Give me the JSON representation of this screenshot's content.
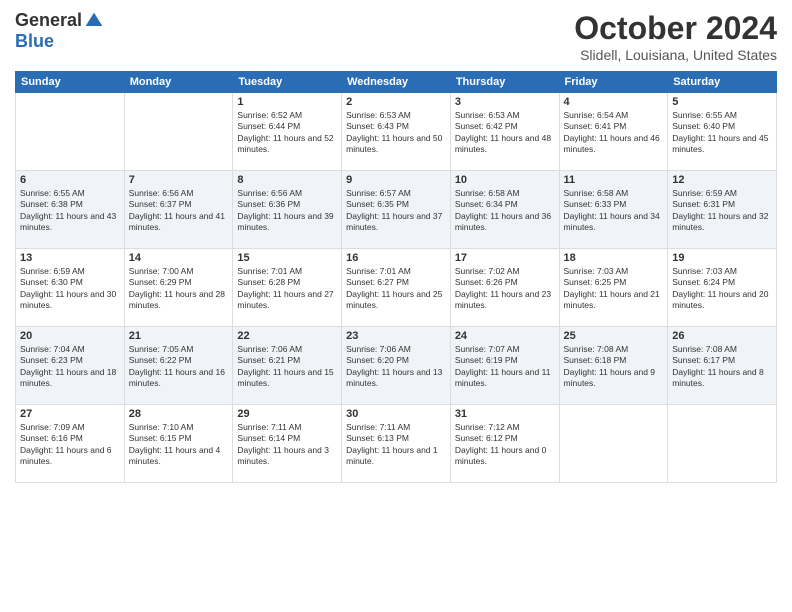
{
  "logo": {
    "general": "General",
    "blue": "Blue"
  },
  "header": {
    "month": "October 2024",
    "location": "Slidell, Louisiana, United States"
  },
  "days_of_week": [
    "Sunday",
    "Monday",
    "Tuesday",
    "Wednesday",
    "Thursday",
    "Friday",
    "Saturday"
  ],
  "weeks": [
    [
      {
        "num": "",
        "info": ""
      },
      {
        "num": "",
        "info": ""
      },
      {
        "num": "1",
        "info": "Sunrise: 6:52 AM\nSunset: 6:44 PM\nDaylight: 11 hours and 52 minutes."
      },
      {
        "num": "2",
        "info": "Sunrise: 6:53 AM\nSunset: 6:43 PM\nDaylight: 11 hours and 50 minutes."
      },
      {
        "num": "3",
        "info": "Sunrise: 6:53 AM\nSunset: 6:42 PM\nDaylight: 11 hours and 48 minutes."
      },
      {
        "num": "4",
        "info": "Sunrise: 6:54 AM\nSunset: 6:41 PM\nDaylight: 11 hours and 46 minutes."
      },
      {
        "num": "5",
        "info": "Sunrise: 6:55 AM\nSunset: 6:40 PM\nDaylight: 11 hours and 45 minutes."
      }
    ],
    [
      {
        "num": "6",
        "info": "Sunrise: 6:55 AM\nSunset: 6:38 PM\nDaylight: 11 hours and 43 minutes."
      },
      {
        "num": "7",
        "info": "Sunrise: 6:56 AM\nSunset: 6:37 PM\nDaylight: 11 hours and 41 minutes."
      },
      {
        "num": "8",
        "info": "Sunrise: 6:56 AM\nSunset: 6:36 PM\nDaylight: 11 hours and 39 minutes."
      },
      {
        "num": "9",
        "info": "Sunrise: 6:57 AM\nSunset: 6:35 PM\nDaylight: 11 hours and 37 minutes."
      },
      {
        "num": "10",
        "info": "Sunrise: 6:58 AM\nSunset: 6:34 PM\nDaylight: 11 hours and 36 minutes."
      },
      {
        "num": "11",
        "info": "Sunrise: 6:58 AM\nSunset: 6:33 PM\nDaylight: 11 hours and 34 minutes."
      },
      {
        "num": "12",
        "info": "Sunrise: 6:59 AM\nSunset: 6:31 PM\nDaylight: 11 hours and 32 minutes."
      }
    ],
    [
      {
        "num": "13",
        "info": "Sunrise: 6:59 AM\nSunset: 6:30 PM\nDaylight: 11 hours and 30 minutes."
      },
      {
        "num": "14",
        "info": "Sunrise: 7:00 AM\nSunset: 6:29 PM\nDaylight: 11 hours and 28 minutes."
      },
      {
        "num": "15",
        "info": "Sunrise: 7:01 AM\nSunset: 6:28 PM\nDaylight: 11 hours and 27 minutes."
      },
      {
        "num": "16",
        "info": "Sunrise: 7:01 AM\nSunset: 6:27 PM\nDaylight: 11 hours and 25 minutes."
      },
      {
        "num": "17",
        "info": "Sunrise: 7:02 AM\nSunset: 6:26 PM\nDaylight: 11 hours and 23 minutes."
      },
      {
        "num": "18",
        "info": "Sunrise: 7:03 AM\nSunset: 6:25 PM\nDaylight: 11 hours and 21 minutes."
      },
      {
        "num": "19",
        "info": "Sunrise: 7:03 AM\nSunset: 6:24 PM\nDaylight: 11 hours and 20 minutes."
      }
    ],
    [
      {
        "num": "20",
        "info": "Sunrise: 7:04 AM\nSunset: 6:23 PM\nDaylight: 11 hours and 18 minutes."
      },
      {
        "num": "21",
        "info": "Sunrise: 7:05 AM\nSunset: 6:22 PM\nDaylight: 11 hours and 16 minutes."
      },
      {
        "num": "22",
        "info": "Sunrise: 7:06 AM\nSunset: 6:21 PM\nDaylight: 11 hours and 15 minutes."
      },
      {
        "num": "23",
        "info": "Sunrise: 7:06 AM\nSunset: 6:20 PM\nDaylight: 11 hours and 13 minutes."
      },
      {
        "num": "24",
        "info": "Sunrise: 7:07 AM\nSunset: 6:19 PM\nDaylight: 11 hours and 11 minutes."
      },
      {
        "num": "25",
        "info": "Sunrise: 7:08 AM\nSunset: 6:18 PM\nDaylight: 11 hours and 9 minutes."
      },
      {
        "num": "26",
        "info": "Sunrise: 7:08 AM\nSunset: 6:17 PM\nDaylight: 11 hours and 8 minutes."
      }
    ],
    [
      {
        "num": "27",
        "info": "Sunrise: 7:09 AM\nSunset: 6:16 PM\nDaylight: 11 hours and 6 minutes."
      },
      {
        "num": "28",
        "info": "Sunrise: 7:10 AM\nSunset: 6:15 PM\nDaylight: 11 hours and 4 minutes."
      },
      {
        "num": "29",
        "info": "Sunrise: 7:11 AM\nSunset: 6:14 PM\nDaylight: 11 hours and 3 minutes."
      },
      {
        "num": "30",
        "info": "Sunrise: 7:11 AM\nSunset: 6:13 PM\nDaylight: 11 hours and 1 minute."
      },
      {
        "num": "31",
        "info": "Sunrise: 7:12 AM\nSunset: 6:12 PM\nDaylight: 11 hours and 0 minutes."
      },
      {
        "num": "",
        "info": ""
      },
      {
        "num": "",
        "info": ""
      }
    ]
  ]
}
